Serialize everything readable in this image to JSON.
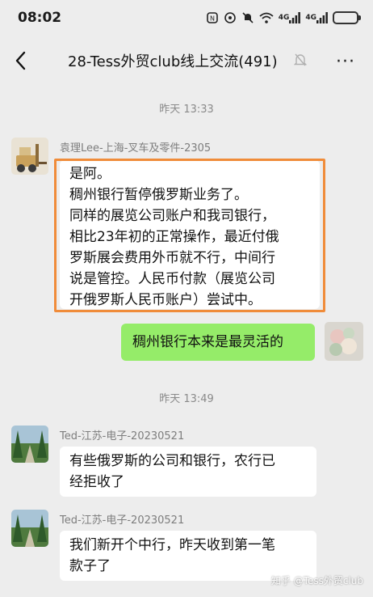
{
  "status_bar": {
    "time": "08:02",
    "signal1_label": "4G",
    "signal2_label": "4G",
    "icons": [
      "nfc-icon",
      "vibrate-icon",
      "mute-bell-icon",
      "wifi-icon",
      "signal-icon",
      "signal-icon",
      "battery-icon"
    ]
  },
  "header": {
    "title": "28-Tess外贸club线上交流(491)",
    "back_icon": "chevron-left-icon",
    "mute_icon": "muted-bell-icon",
    "more_label": "···"
  },
  "chat": {
    "timestamp1": "昨天 13:33",
    "msg1": {
      "sender": "袁理Lee-上海-叉车及零件-2305",
      "lines": [
        "是阿。",
        "稠州银行暂停俄罗斯业务了。",
        "同样的展览公司账户和我司银行，",
        "相比23年初的正常操作，最近付俄",
        "罗斯展会费用外币就不行，中间行",
        "说是管控。人民币付款（展览公司",
        "开俄罗斯人民币账户）尝试中。"
      ]
    },
    "msg2": {
      "text": "稠州银行本来是最灵活的"
    },
    "timestamp2": "昨天 13:49",
    "msg3": {
      "sender": "Ted-江苏-电子-20230521",
      "lines": [
        "有些俄罗斯的公司和银行，农行已",
        "经拒收了"
      ]
    },
    "msg4": {
      "sender": "Ted-江苏-电子-20230521",
      "lines": [
        "我们新开个中行，昨天收到第一笔",
        "款子了"
      ]
    }
  },
  "watermark": "知乎 @Tess外贸club",
  "colors": {
    "background": "#ededed",
    "self_bubble": "#95ec69",
    "other_bubble": "#ffffff",
    "highlight_border": "#f08c3a"
  }
}
